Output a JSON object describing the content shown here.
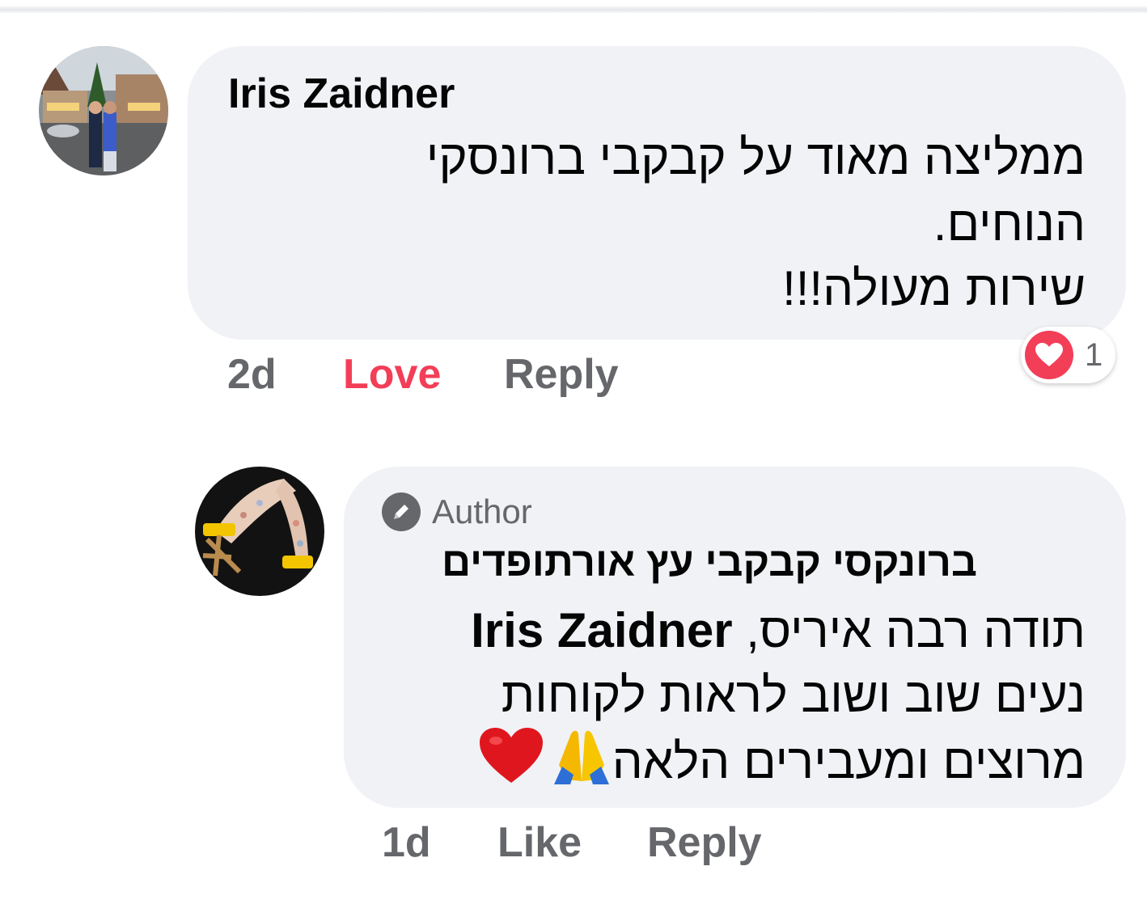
{
  "comments": [
    {
      "author": "Iris Zaidner",
      "lines": [
        "ממליצה מאוד על קבקבי ברונסקי",
        "הנוחים.",
        "שירות מעולה!!!"
      ],
      "time": "2d",
      "like_label": "Love",
      "reply_label": "Reply",
      "reaction": {
        "icon": "heart-icon",
        "count": "1",
        "color": "#f33e58"
      }
    }
  ],
  "reply": {
    "badge_label": "Author",
    "badge_icon": "pencil-icon",
    "author": "ברונקסי קבקבי עץ אורתופדים",
    "mention": "Iris Zaidner",
    "line1_text": "תודה רבה איריס,",
    "line2": "נעים שוב ושוב לראות לקוחות",
    "line3_text": "מרוצים ומעבירים הלאה",
    "emojis": [
      "folded-hands-icon",
      "red-heart-icon"
    ],
    "time": "1d",
    "like_label": "Like",
    "reply_label": "Reply"
  },
  "colors": {
    "bubble": "#f0f2f5",
    "secondary_text": "#65676b",
    "love": "#f33e58",
    "primary_text": "#050505"
  }
}
